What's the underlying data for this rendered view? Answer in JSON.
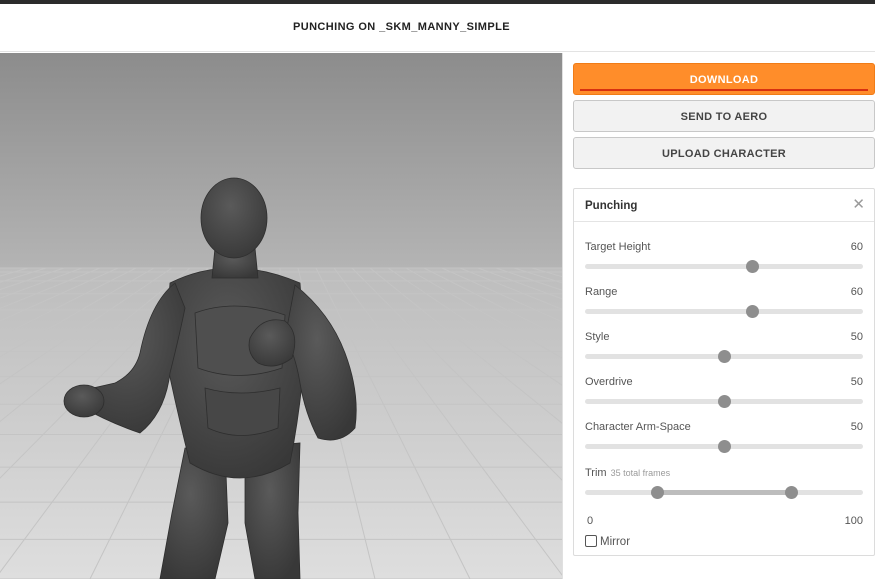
{
  "header": {
    "title": "PUNCHING ON _SKM_MANNY_SIMPLE"
  },
  "viewport": {
    "figure_color": "#4a4a4a",
    "floor_color": "#cfcfcf",
    "sky_color": "#8f8f8f"
  },
  "actions": {
    "download_label": "DOWNLOAD",
    "send_label": "SEND TO AERO",
    "upload_label": "UPLOAD CHARACTER",
    "accent_color": "#ff8d2a"
  },
  "settings": {
    "title": "Punching",
    "close_icon": "close-icon",
    "sliders": [
      {
        "label": "Target Height",
        "value": "60",
        "level": 60
      },
      {
        "label": "Range",
        "value": "60",
        "level": 60
      },
      {
        "label": "Style",
        "value": "50",
        "level": 50
      },
      {
        "label": "Overdrive",
        "value": "50",
        "level": 50
      },
      {
        "label": "Character Arm-Space",
        "value": "50",
        "level": 50
      }
    ],
    "trim": {
      "label": "Trim",
      "subtitle": "35 total frames",
      "min_label": "0",
      "max_label": "100",
      "start": 26,
      "end": 74
    },
    "mirror_label": "Mirror",
    "mirror_checked": false
  }
}
